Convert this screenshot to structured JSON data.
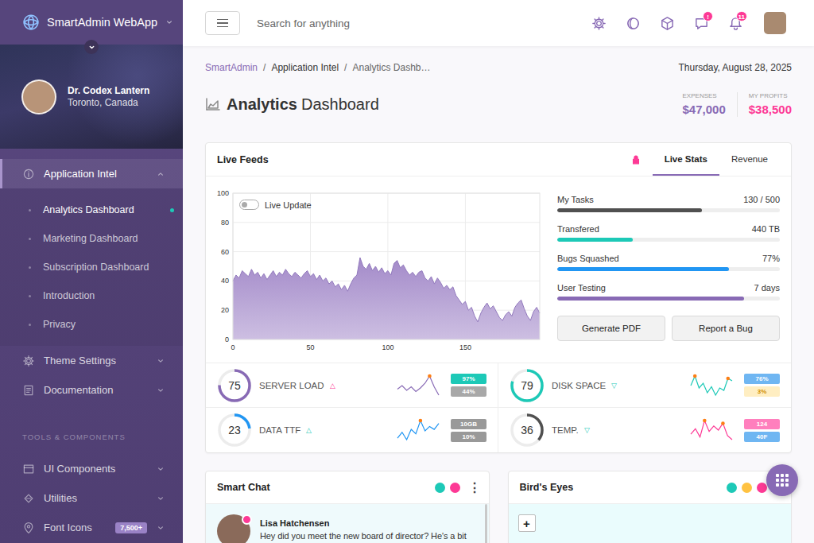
{
  "sidebar": {
    "logo": "SmartAdmin WebApp",
    "profile": {
      "name": "Dr. Codex Lantern",
      "location": "Toronto, Canada"
    },
    "nav": [
      {
        "label": "Application Intel",
        "expanded": true,
        "selected": true,
        "children": [
          {
            "label": "Analytics Dashboard",
            "selected": true
          },
          {
            "label": "Marketing Dashboard",
            "selected": false
          },
          {
            "label": "Subscription Dashboard",
            "selected": false
          },
          {
            "label": "Introduction",
            "selected": false
          },
          {
            "label": "Privacy",
            "selected": false
          }
        ]
      },
      {
        "label": "Theme Settings",
        "expanded": false,
        "selected": false,
        "children": []
      },
      {
        "label": "Documentation",
        "expanded": false,
        "selected": false,
        "children": []
      }
    ],
    "section_title": "TOOLS & COMPONENTS",
    "tools": [
      {
        "label": "UI Components",
        "expanded": false
      },
      {
        "label": "Utilities",
        "expanded": false
      },
      {
        "label": "Font Icons",
        "expanded": false,
        "badge": "7,500+"
      }
    ]
  },
  "header": {
    "search_placeholder": "Search for anything",
    "messages_badge": "!",
    "notifications_badge": "11"
  },
  "page": {
    "breadcrumb": [
      "SmartAdmin",
      "Application Intel",
      "Analytics Dashb…"
    ],
    "separator": "/",
    "date": "Thursday, August 28, 2025",
    "title": {
      "strong": "Analytics",
      "light": "Dashboard"
    },
    "summary": [
      {
        "label": "EXPENSES",
        "value": "$47,000",
        "color": "#886ab5"
      },
      {
        "label": "MY PROFITS",
        "value": "$38,500",
        "color": "#fd3995"
      }
    ]
  },
  "live_feeds": {
    "title": "Live Feeds",
    "tabs": [
      {
        "label": "Live Stats",
        "selected": true
      },
      {
        "label": "Revenue",
        "selected": false
      }
    ],
    "toggle": {
      "label": "Live Update",
      "on": false
    },
    "chart": {
      "y_ticks": [
        "100",
        "80",
        "60",
        "40",
        "20",
        "0"
      ],
      "x_ticks": [
        "0",
        "50",
        "100",
        "150"
      ],
      "x_step": 2,
      "values": [
        40,
        44,
        42,
        47,
        45,
        43,
        48,
        44,
        46,
        42,
        45,
        41,
        44,
        47,
        43,
        46,
        44,
        48,
        45,
        43,
        46,
        44,
        42,
        45,
        47,
        43,
        45,
        41,
        44,
        40,
        42,
        38,
        40,
        36,
        38,
        34,
        37,
        33,
        38,
        42,
        44,
        56,
        50,
        48,
        52,
        47,
        50,
        46,
        49,
        45,
        47,
        44,
        52,
        54,
        49,
        51,
        47,
        44,
        46,
        43,
        46,
        47,
        42,
        40,
        43,
        38,
        42,
        39,
        35,
        37,
        34,
        36,
        30,
        27,
        24,
        26,
        20,
        22,
        16,
        12,
        18,
        22,
        25,
        21,
        23,
        19,
        15,
        13,
        17,
        19,
        16,
        22,
        25,
        27,
        21,
        16,
        13,
        19,
        22,
        18
      ]
    },
    "progress": [
      {
        "label": "My Tasks",
        "value": "130 / 500",
        "level": 0.65,
        "color": "#505050"
      },
      {
        "label": "Transfered",
        "value": "440 TB",
        "level": 0.34,
        "color": "#1dc9b7"
      },
      {
        "label": "Bugs Squashed",
        "value": "77%",
        "level": 0.77,
        "color": "#2196f3"
      },
      {
        "label": "User Testing",
        "value": "7 days",
        "level": 0.84,
        "color": "#886ab5"
      }
    ],
    "buttons": [
      "Generate PDF",
      "Report a Bug"
    ],
    "gauges": [
      {
        "value": "75",
        "level": 0.75,
        "label": "SERVER LOAD",
        "trend": "△",
        "trend_color": "#fd3995",
        "color": "#886ab5",
        "sparkline": {
          "values": [
            14,
            17,
            13,
            16,
            12,
            15,
            19,
            25,
            16,
            9
          ],
          "highlight": [
            7
          ],
          "color": "#886ab5"
        },
        "badges": [
          {
            "text": "97%",
            "color": "#1dc9b7",
            "text_color": "#ffffff"
          },
          {
            "text": "44%",
            "color": "#a8a8a8",
            "text_color": "#ffffff"
          }
        ]
      },
      {
        "value": "79",
        "level": 0.79,
        "label": "DISK SPACE",
        "trend": "▽",
        "trend_color": "#1dc9b7",
        "color": "#1dc9b7",
        "sparkline": {
          "values": [
            16,
            24,
            14,
            18,
            10,
            15,
            8,
            14,
            12,
            22,
            20
          ],
          "highlight": [
            1,
            9
          ],
          "color": "#1dc9b7"
        },
        "badges": [
          {
            "text": "76%",
            "color": "#6fb6f2",
            "text_color": "#ffffff"
          },
          {
            "text": "3%",
            "color": "#ffeec2",
            "text_color": "#d08e00"
          }
        ]
      },
      {
        "value": "23",
        "level": 0.23,
        "label": "DATA TTF",
        "trend": "△",
        "trend_color": "#1dc9b7",
        "color": "#2196f3",
        "sparkline": {
          "values": [
            10,
            14,
            9,
            16,
            13,
            22,
            15,
            18,
            16,
            20
          ],
          "highlight": [
            5
          ],
          "color": "#2196f3"
        },
        "badges": [
          {
            "text": "10GB",
            "color": "#999999",
            "text_color": "#ffffff"
          },
          {
            "text": "10%",
            "color": "#999999",
            "text_color": "#ffffff"
          }
        ]
      },
      {
        "value": "36",
        "level": 0.36,
        "label": "TEMP.",
        "trend": "▽",
        "trend_color": "#1dc9b7",
        "color": "#505050",
        "sparkline": {
          "values": [
            12,
            16,
            10,
            22,
            14,
            18,
            15,
            20,
            11,
            8
          ],
          "highlight": [
            3,
            7
          ],
          "color": "#fd3995"
        },
        "badges": [
          {
            "text": "124",
            "color": "#ff7fbd",
            "text_color": "#ffffff"
          },
          {
            "text": "40F",
            "color": "#6fb6f2",
            "text_color": "#ffffff"
          }
        ]
      }
    ]
  },
  "chat": {
    "title": "Smart Chat",
    "dots": [
      {
        "color": "#1dc9b7"
      },
      {
        "color": "#fd3995"
      }
    ],
    "menu": "⋮",
    "messages": [
      {
        "name": "Lisa Hatchensen",
        "text": "Hey did you meet the new board of director? He's a bit",
        "status_color": "#fd3995"
      }
    ]
  },
  "birds_eye": {
    "title": "Bird's Eyes",
    "dots": [
      {
        "color": "#1dc9b7"
      },
      {
        "color": "#ffc241"
      },
      {
        "color": "#fd3995"
      }
    ],
    "zoom_in": "+"
  }
}
